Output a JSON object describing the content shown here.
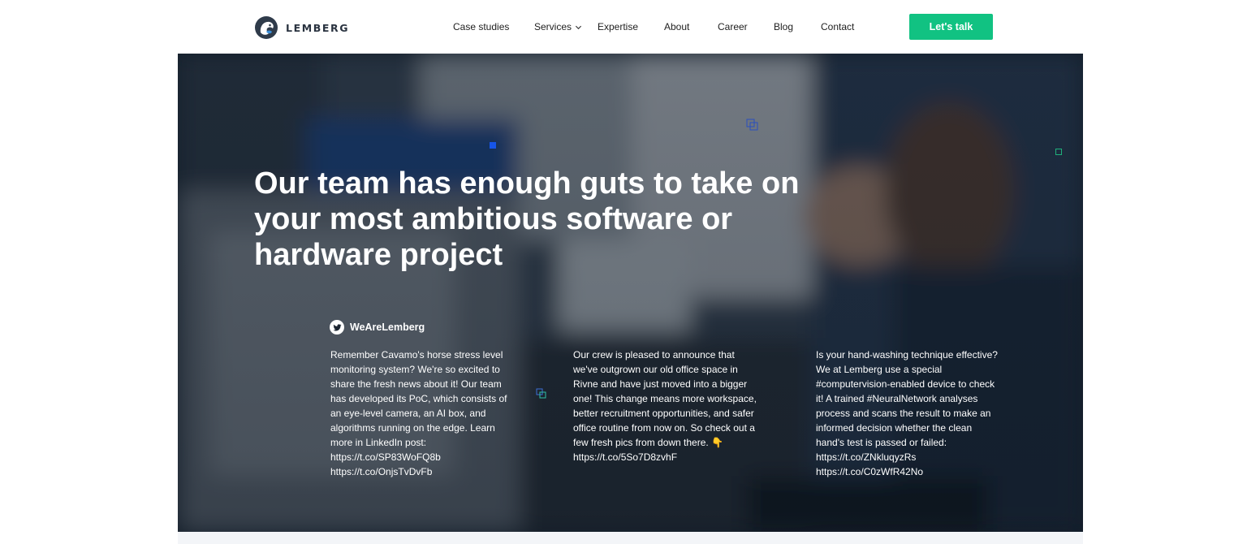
{
  "brand": {
    "name": "LEMBERG",
    "accent": "#11c282",
    "logo_color": "#2f3b4a"
  },
  "nav": {
    "items": [
      {
        "label": "Case studies"
      },
      {
        "label": "Services",
        "has_dropdown": true
      },
      {
        "label": "Expertise"
      },
      {
        "label": "About"
      },
      {
        "label": "Career"
      },
      {
        "label": "Blog"
      },
      {
        "label": "Contact"
      }
    ],
    "cta_label": "Let's talk"
  },
  "hero": {
    "title": "Our team has enough guts to take on your most ambitious software or hardware project"
  },
  "twitter": {
    "icon": "twitter-icon",
    "handle": "WeAreLemberg",
    "tweets": [
      {
        "text": "Remember Cavamo's horse stress level monitoring system? We're so excited to share the fresh news about it! Our team has developed its PoC, which consists of an eye-level camera, an AI box, and algorithms running on the edge. Learn more in LinkedIn post:",
        "links": [
          "https://t.co/SP83WoFQ8b",
          "https://t.co/OnjsTvDvFb"
        ]
      },
      {
        "text": "Our crew is pleased to announce that we've outgrown our old office space in Rivne and have just moved into a bigger one! This change means more workspace, better recruitment opportunities, and safer office routine from now on. So check out a few fresh pics from down there. 👇",
        "links": [
          "https://t.co/5So7D8zvhF"
        ]
      },
      {
        "text": "Is your hand-washing technique effective? We at Lemberg use a special #computervision-enabled device to check it! A trained #NeuralNetwork analyses process and scans the result to make an informed decision whether the clean hand's test is passed or failed:",
        "links": [
          "https://t.co/ZNkluqyzRs",
          "https://t.co/C0zWfR42No"
        ]
      }
    ]
  }
}
